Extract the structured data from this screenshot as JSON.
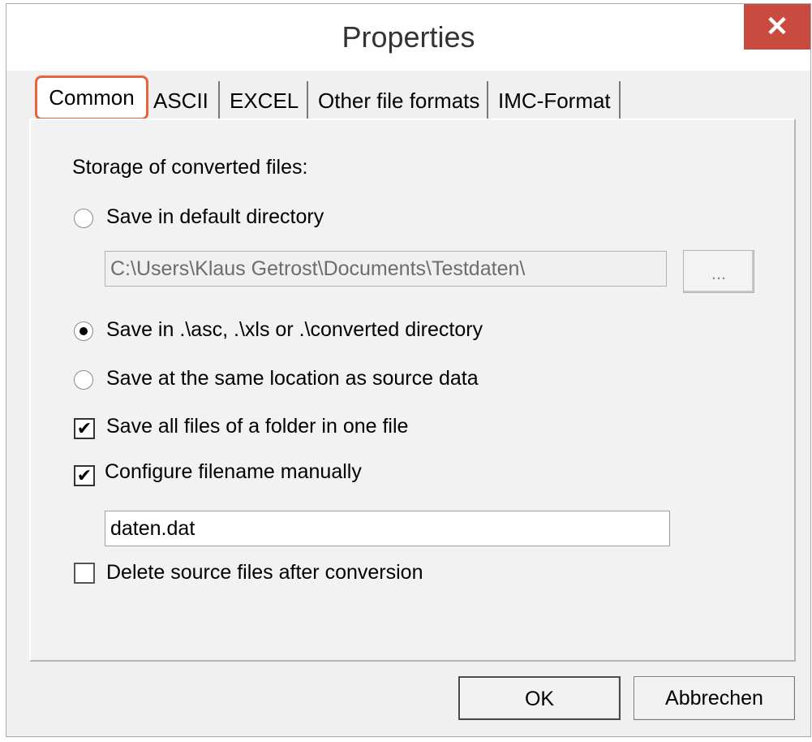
{
  "window": {
    "title": "Properties",
    "close_symbol": "✕"
  },
  "tabs": [
    "Common",
    "ASCII",
    "EXCEL",
    "Other file formats",
    "IMC-Format"
  ],
  "active_tab": "Common",
  "panel": {
    "storage_label": "Storage of converted files:",
    "radio_default_dir": {
      "label": "Save in default directory",
      "checked": false
    },
    "default_dir_path": "C:\\Users\\Klaus Getrost\\Documents\\Testdaten\\",
    "browse_label": "...",
    "radio_converted_dir": {
      "label": "Save in .\\asc, .\\xls or .\\converted directory",
      "checked": true
    },
    "radio_same_location": {
      "label": "Save at the same location as source data",
      "checked": false
    },
    "check_one_file": {
      "label": "Save all files of a folder in one file",
      "checked": true
    },
    "check_filename_manual": {
      "label": "Configure filename manually",
      "checked": true
    },
    "filename_value": "daten.dat",
    "check_delete_source": {
      "label": "Delete source files after conversion",
      "checked": false
    }
  },
  "buttons": {
    "ok": "OK",
    "cancel": "Abbrechen"
  },
  "colors": {
    "close": "#c94a3f",
    "tab_highlight": "#e8643f",
    "dialog_bg": "#f0f0f0"
  }
}
